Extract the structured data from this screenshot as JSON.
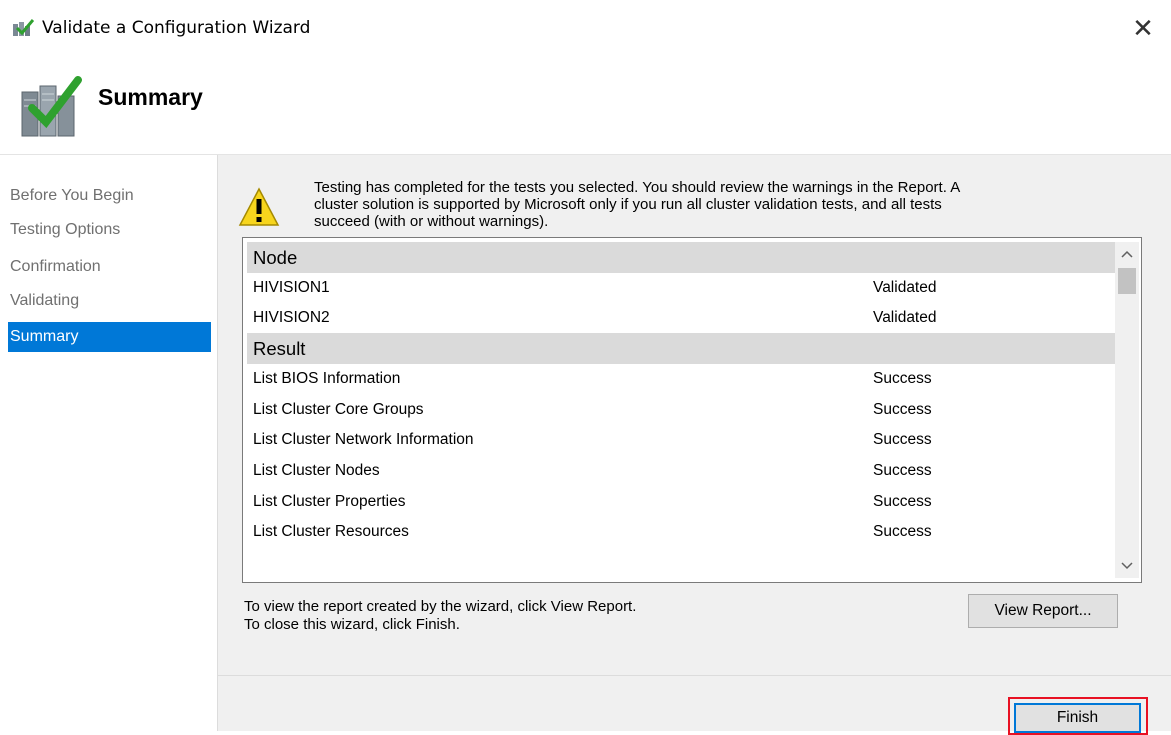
{
  "window": {
    "title": "Validate a Configuration Wizard",
    "close_glyph": "✕"
  },
  "header": {
    "title": "Summary"
  },
  "nav": {
    "items": [
      {
        "label": "Before You Begin"
      },
      {
        "label": "Testing Options"
      },
      {
        "label": "Confirmation"
      },
      {
        "label": "Validating"
      },
      {
        "label": "Summary"
      }
    ],
    "active_index": 4
  },
  "content": {
    "message_line1": "Testing has completed for the tests you selected. You should review the warnings in the Report.  A",
    "message_line2": "cluster solution is supported by Microsoft only if you run all cluster validation tests, and all tests",
    "message_line3": "succeed (with or without warnings).",
    "list": {
      "rows": [
        {
          "type": "group",
          "name": "Node",
          "value": ""
        },
        {
          "type": "item",
          "name": "HIVISION1",
          "value": "Validated"
        },
        {
          "type": "item",
          "name": "HIVISION2",
          "value": "Validated"
        },
        {
          "type": "group",
          "name": "Result",
          "value": ""
        },
        {
          "type": "item",
          "name": "List BIOS Information",
          "value": "Success"
        },
        {
          "type": "item",
          "name": "List Cluster Core Groups",
          "value": "Success"
        },
        {
          "type": "item",
          "name": "List Cluster Network Information",
          "value": "Success"
        },
        {
          "type": "item",
          "name": "List Cluster Nodes",
          "value": "Success"
        },
        {
          "type": "item",
          "name": "List Cluster Properties",
          "value": "Success"
        },
        {
          "type": "item",
          "name": "List Cluster Resources",
          "value": "Success"
        }
      ]
    },
    "info_line1": "To view the report created by the wizard, click View Report.",
    "info_line2": "To close this wizard, click Finish.",
    "view_report_label": "View Report..."
  },
  "footer": {
    "finish_label": "Finish"
  },
  "colors": {
    "accent": "#0078d7",
    "highlight": "#e81123"
  }
}
